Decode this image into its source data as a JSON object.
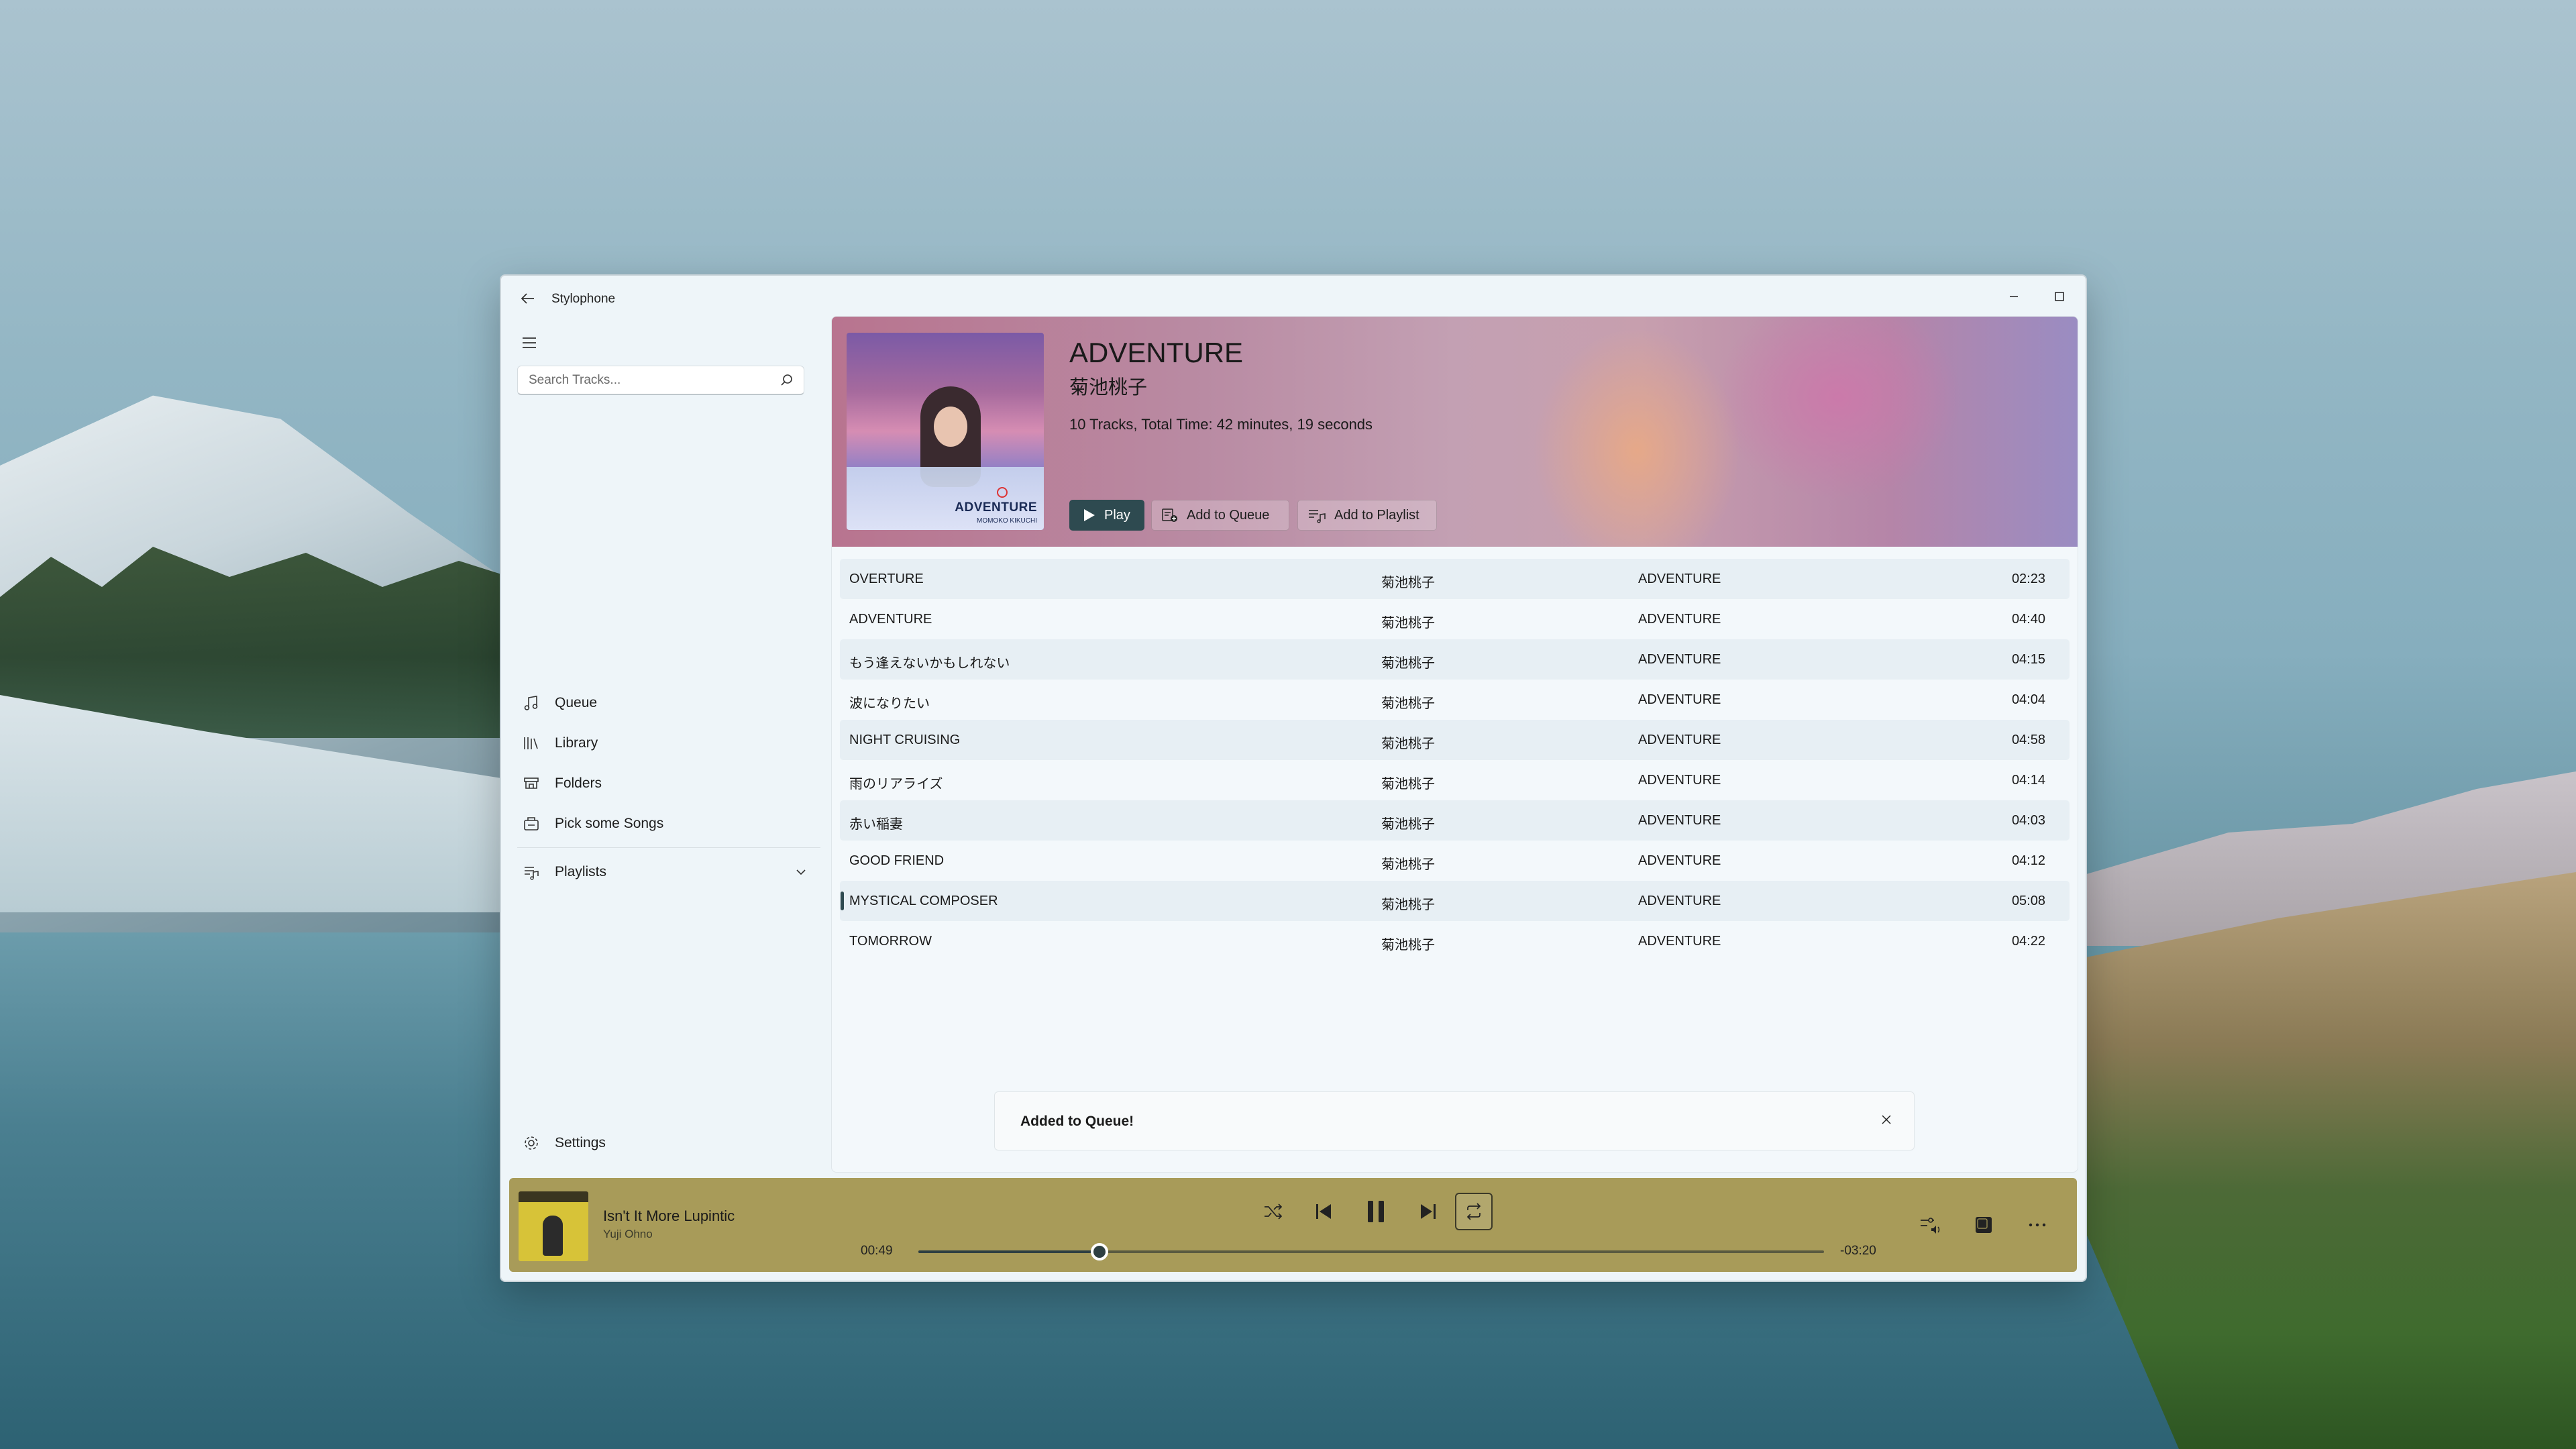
{
  "window": {
    "app_title": "Stylophone"
  },
  "sidebar": {
    "search_placeholder": "Search Tracks...",
    "items": [
      {
        "label": "Queue",
        "icon": "music-note-icon"
      },
      {
        "label": "Library",
        "icon": "library-icon"
      },
      {
        "label": "Folders",
        "icon": "folders-icon"
      },
      {
        "label": "Pick some Songs",
        "icon": "shuffle-pick-icon"
      }
    ],
    "playlists_label": "Playlists",
    "settings_label": "Settings"
  },
  "album": {
    "title": "ADVENTURE",
    "artist": "菊池桃子",
    "meta": "10 Tracks, Total Time: 42 minutes, 19 seconds",
    "cover_text": "ADVENTURE",
    "cover_subtext": "MOMOKO KIKUCHI",
    "play_label": "Play",
    "add_queue_label": "Add to Queue",
    "add_playlist_label": "Add to Playlist"
  },
  "tracks": [
    {
      "title": "OVERTURE",
      "artist": "菊池桃子",
      "album": "ADVENTURE",
      "duration": "02:23"
    },
    {
      "title": "ADVENTURE",
      "artist": "菊池桃子",
      "album": "ADVENTURE",
      "duration": "04:40"
    },
    {
      "title": "もう逢えないかもしれない",
      "artist": "菊池桃子",
      "album": "ADVENTURE",
      "duration": "04:15"
    },
    {
      "title": "波になりたい",
      "artist": "菊池桃子",
      "album": "ADVENTURE",
      "duration": "04:04"
    },
    {
      "title": "NIGHT CRUISING",
      "artist": "菊池桃子",
      "album": "ADVENTURE",
      "duration": "04:58"
    },
    {
      "title": "雨のリアライズ",
      "artist": "菊池桃子",
      "album": "ADVENTURE",
      "duration": "04:14"
    },
    {
      "title": "赤い稲妻",
      "artist": "菊池桃子",
      "album": "ADVENTURE",
      "duration": "04:03"
    },
    {
      "title": "GOOD FRIEND",
      "artist": "菊池桃子",
      "album": "ADVENTURE",
      "duration": "04:12"
    },
    {
      "title": "MYSTICAL COMPOSER",
      "artist": "菊池桃子",
      "album": "ADVENTURE",
      "duration": "05:08",
      "selected": true
    },
    {
      "title": "TOMORROW",
      "artist": "菊池桃子",
      "album": "ADVENTURE",
      "duration": "04:22"
    }
  ],
  "toast": {
    "message": "Added to Queue!"
  },
  "player": {
    "title": "Isn't It More Lupintic",
    "artist": "Yuji Ohno",
    "elapsed": "00:49",
    "remaining": "-03:20",
    "progress_fraction": 0.2
  },
  "colors": {
    "accent": "#2e4a50",
    "player_bg": "#a89b59",
    "window_bg": "#eef5f9"
  }
}
